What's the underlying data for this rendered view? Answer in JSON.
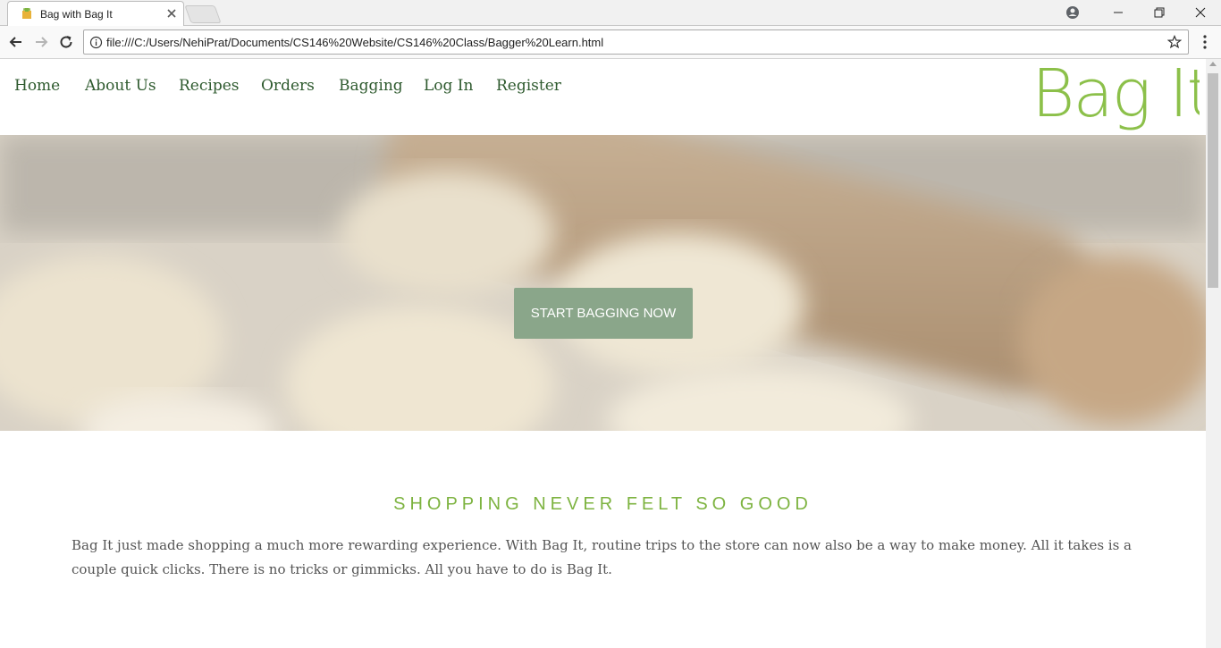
{
  "browser": {
    "tab_title": "Bag with Bag It",
    "url": "file:///C:/Users/NehiPrat/Documents/CS146%20Website/CS146%20Class/Bagger%20Learn.html"
  },
  "nav": {
    "items": [
      {
        "label": "Home"
      },
      {
        "label": "About Us"
      },
      {
        "label": "Recipes"
      },
      {
        "label": "Orders"
      },
      {
        "label": "Bagging"
      },
      {
        "label": "Log In"
      },
      {
        "label": "Register"
      }
    ],
    "logo_text": "Bag It"
  },
  "hero": {
    "cta_label": "START BAGGING NOW"
  },
  "section": {
    "title": "SHOPPING NEVER FELT SO GOOD",
    "body": "Bag It just made shopping a much more rewarding experience. With Bag It, routine trips to the store can now also be a way to make money. All it takes is a couple quick clicks. There is no tricks or gimmicks. All you have to do is Bag It."
  },
  "colors": {
    "accent_green": "#7db340",
    "nav_text": "#2e5a2e",
    "cta_bg": "#8aa68a"
  }
}
